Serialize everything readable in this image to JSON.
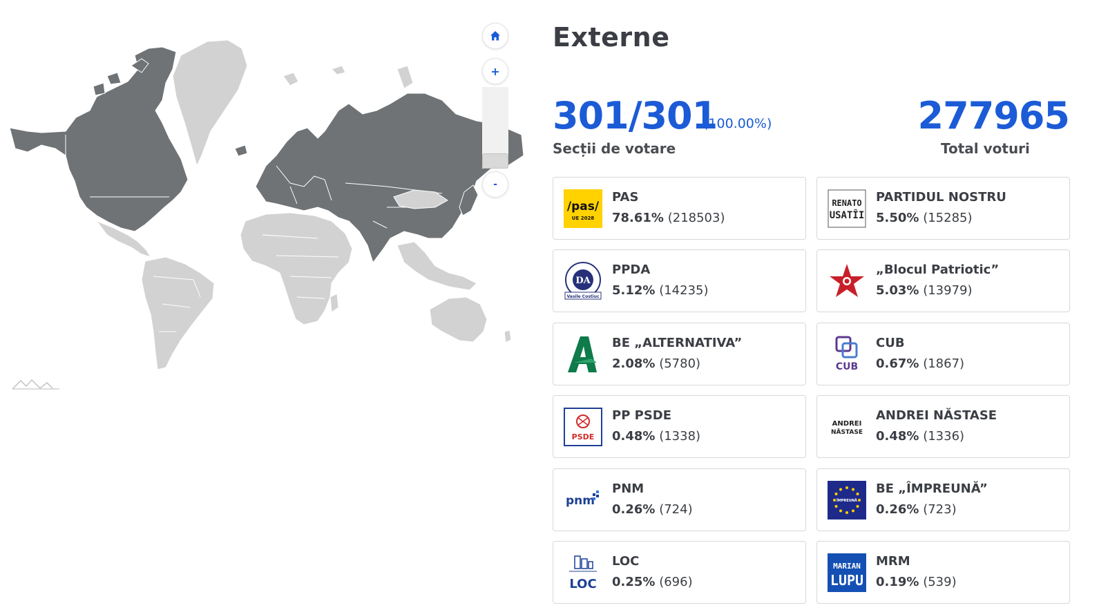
{
  "map": {
    "controls": {
      "home": "⌂",
      "zoom_in": "+",
      "zoom_out": "-"
    },
    "colors": {
      "voting": "#6f7375",
      "no_voting": "#d2d2d2",
      "accent": "#1c5bd6"
    }
  },
  "region": {
    "title": "Externe",
    "sections_count": "301/301",
    "sections_percent": "(100.00%)",
    "sections_label": "Secții de votare",
    "total_votes": "277965",
    "total_label": "Total voturi"
  },
  "parties": [
    {
      "name": "PAS",
      "percent": "78.61%",
      "votes": "(218503)",
      "logo": "pas-logo",
      "logo_text": "/pas/",
      "logo_sub": "UE 2028",
      "color": "#ffd200"
    },
    {
      "name": "PARTIDUL NOSTRU",
      "percent": "5.50%",
      "votes": "(15285)",
      "logo": "renato-usatii-logo",
      "logo_text": "RENATO",
      "logo_sub": "USATÎI",
      "color": "#222222"
    },
    {
      "name": "PPDA",
      "percent": "5.12%",
      "votes": "(14235)",
      "logo": "ppda-logo",
      "logo_text": "DA",
      "logo_sub": "Vasile Costiuc",
      "color": "#27317a"
    },
    {
      "name": "„Blocul Patriotic”",
      "percent": "5.03%",
      "votes": "(13979)",
      "logo": "star-logo",
      "logo_text": "",
      "logo_sub": "",
      "color": "#c8202a"
    },
    {
      "name": "BE „ALTERNATIVA”",
      "percent": "2.08%",
      "votes": "(5780)",
      "logo": "alternativa-logo",
      "logo_text": "A",
      "logo_sub": "",
      "color": "#0f7a4a"
    },
    {
      "name": "CUB",
      "percent": "0.67%",
      "votes": "(1867)",
      "logo": "cub-logo",
      "logo_text": "CUB",
      "logo_sub": "",
      "color": "#5b3a8e"
    },
    {
      "name": "PP PSDE",
      "percent": "0.48%",
      "votes": "(1338)",
      "logo": "psde-logo",
      "logo_text": "PSDE",
      "logo_sub": "",
      "color": "#d22a2a"
    },
    {
      "name": "ANDREI NĂSTASE",
      "percent": "0.48%",
      "votes": "(1336)",
      "logo": "andrei-nastase-logo",
      "logo_text": "ANDREI",
      "logo_sub": "NĂSTASE",
      "color": "#222222"
    },
    {
      "name": "PNM",
      "percent": "0.26%",
      "votes": "(724)",
      "logo": "pnm-logo",
      "logo_text": "pnm",
      "logo_sub": "",
      "color": "#1d3f95"
    },
    {
      "name": "BE „ÎMPREUNĂ”",
      "percent": "0.26%",
      "votes": "(723)",
      "logo": "impreuna-logo",
      "logo_text": "ÎMPREUNĂ",
      "logo_sub": "",
      "color": "#1e2a8a"
    },
    {
      "name": "LOC",
      "percent": "0.25%",
      "votes": "(696)",
      "logo": "loc-logo",
      "logo_text": "LOC",
      "logo_sub": "",
      "color": "#1d3f95"
    },
    {
      "name": "MRM",
      "percent": "0.19%",
      "votes": "(539)",
      "logo": "marian-lupu-logo",
      "logo_text": "MARIAN",
      "logo_sub": "LUPU",
      "color": "#1450b4"
    }
  ]
}
